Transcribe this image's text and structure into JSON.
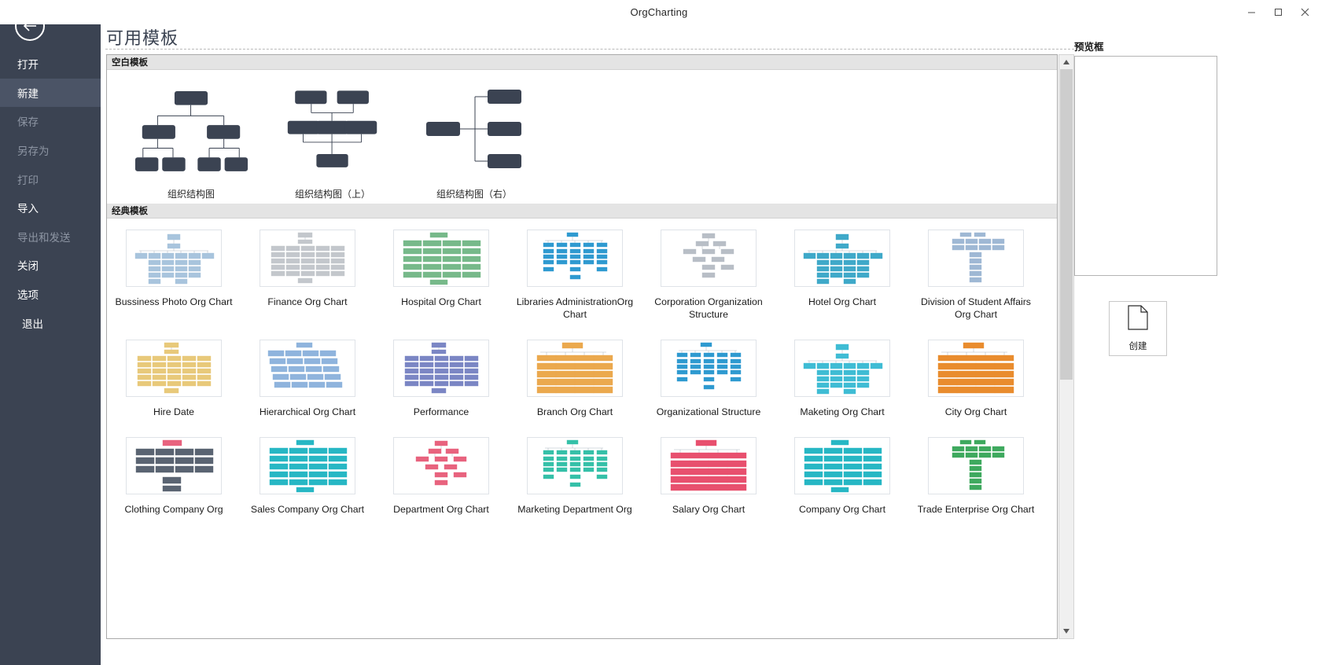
{
  "window": {
    "title": "OrgCharting",
    "minimize_label": "–",
    "maximize_label": "❐",
    "close_label": "✕"
  },
  "sidebar": {
    "back_icon": "back-arrow-icon",
    "items": [
      {
        "label": "打开",
        "state": "enabled"
      },
      {
        "label": "新建",
        "state": "active"
      },
      {
        "label": "保存",
        "state": "disabled"
      },
      {
        "label": "另存为",
        "state": "disabled"
      },
      {
        "label": "打印",
        "state": "disabled"
      },
      {
        "label": "导入",
        "state": "enabled"
      },
      {
        "label": "导出和发送",
        "state": "disabled"
      },
      {
        "label": "关闭",
        "state": "enabled"
      },
      {
        "label": "选项",
        "state": "enabled"
      },
      {
        "label": "退出",
        "state": "enabled"
      }
    ]
  },
  "main": {
    "page_title": "可用模板",
    "blank_group_header": "空白模板",
    "classic_group_header": "经典模板",
    "blank_templates": [
      {
        "label": "组织结构图",
        "layout": "top-down"
      },
      {
        "label": "组织结构图（上）",
        "layout": "bottom-up"
      },
      {
        "label": "组织结构图（右）",
        "layout": "right"
      }
    ],
    "classic_templates": [
      {
        "label": "Bussiness Photo Org Chart",
        "accent": "#a8c4dd",
        "style": "wide"
      },
      {
        "label": "Finance Org Chart",
        "accent": "#c3c7cc",
        "style": "matrix"
      },
      {
        "label": "Hospital Org Chart",
        "accent": "#77b98a",
        "style": "rows"
      },
      {
        "label": "Libraries AdministrationOrg Chart",
        "accent": "#2f9ad0",
        "style": "tree"
      },
      {
        "label": "Corporation Organization Structure",
        "accent": "#b8bec6",
        "style": "sparse"
      },
      {
        "label": "Hotel Org Chart",
        "accent": "#3fa9c9",
        "style": "wide"
      },
      {
        "label": "Division of Student Affairs Org Chart",
        "accent": "#9fb8d4",
        "style": "tall"
      },
      {
        "label": "Hire Date",
        "accent": "#e8c97a",
        "style": "matrix"
      },
      {
        "label": "Hierarchical Org Chart",
        "accent": "#8fb4dd",
        "style": "skew"
      },
      {
        "label": "Performance",
        "accent": "#7b86c4",
        "style": "matrix"
      },
      {
        "label": "Branch Org Chart",
        "accent": "#eba94e",
        "style": "bars"
      },
      {
        "label": "Organizational Structure",
        "accent": "#2f9ad0",
        "style": "tree"
      },
      {
        "label": "Maketing Org Chart",
        "accent": "#3fbcd4",
        "style": "wide"
      },
      {
        "label": "City Org Chart",
        "accent": "#e98c2e",
        "style": "bars"
      },
      {
        "label": "Clothing Company Org",
        "accent": "#e8637e",
        "style": "dark"
      },
      {
        "label": "Sales Company Org Chart",
        "accent": "#27b7c4",
        "style": "rows"
      },
      {
        "label": "Department Org Chart",
        "accent": "#e8637e",
        "style": "sparse"
      },
      {
        "label": "Marketing Department Org",
        "accent": "#35c0a8",
        "style": "tree"
      },
      {
        "label": "Salary Org Chart",
        "accent": "#e8506e",
        "style": "bars"
      },
      {
        "label": "Company Org Chart",
        "accent": "#27b7c4",
        "style": "rows"
      },
      {
        "label": "Trade Enterprise Org Chart",
        "accent": "#3ea95e",
        "style": "tall"
      }
    ]
  },
  "right_panel": {
    "preview_label": "预览框",
    "create_label": "创建",
    "create_icon": "document-page-icon"
  },
  "scrollbar": {
    "up_arrow": "▲",
    "down_arrow": "▼"
  },
  "colors": {
    "sidebar_bg": "#3b4352",
    "sidebar_active": "#4b5466",
    "group_header_bg": "#e4e4e4",
    "node_dark": "#3b4352"
  }
}
